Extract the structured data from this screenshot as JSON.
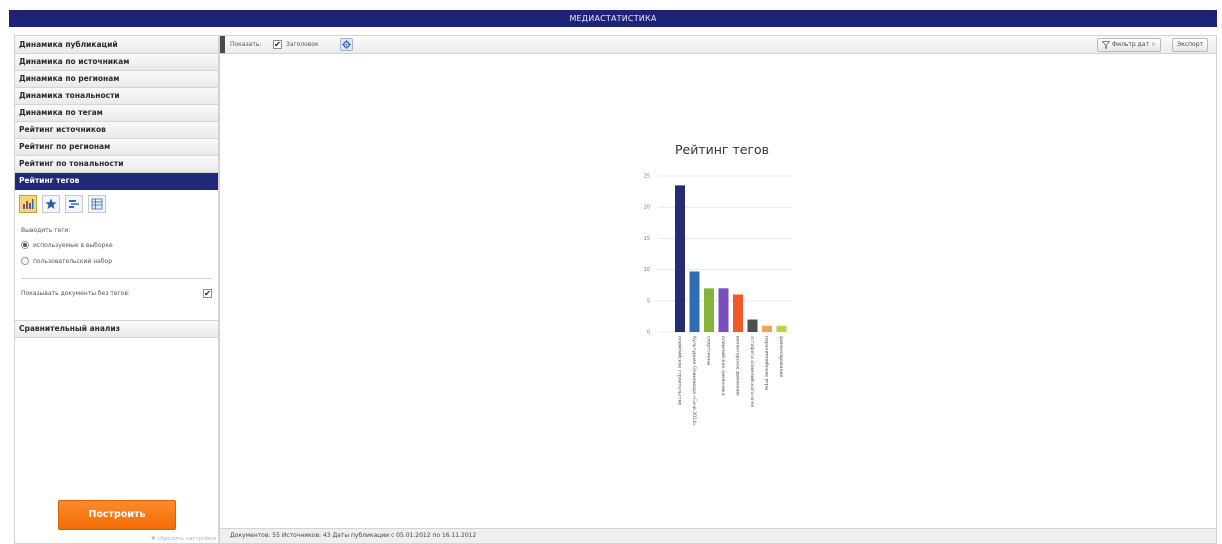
{
  "app": {
    "title": "МЕДИАСТАТИСТИКА"
  },
  "sidebar": {
    "items_top": [
      {
        "label": "Динамика публикаций"
      },
      {
        "label": "Динамика по источникам"
      },
      {
        "label": "Динамика по регионам"
      },
      {
        "label": "Динамика тональности"
      },
      {
        "label": "Динамика по тегам"
      },
      {
        "label": "Рейтинг источников"
      },
      {
        "label": "Рейтинг по регионам"
      },
      {
        "label": "Рейтинг по тональности"
      }
    ],
    "active_item": {
      "label": "Рейтинг тегов"
    },
    "panel": {
      "viz_icons": [
        "bar-chart-icon",
        "star-icon",
        "bars-icon",
        "table-icon"
      ],
      "tags_label": "Выводить теги:",
      "radio_options": [
        {
          "label": "используемые в выборке",
          "selected": true
        },
        {
          "label": "пользовательский набор",
          "selected": false
        }
      ],
      "no_tags_label": "Показывать документы без тегов:",
      "no_tags_checked": true,
      "check_mark": "✔"
    },
    "items_bottom": [
      {
        "label": "Сравнительный анализ"
      }
    ],
    "build_button": "Построить",
    "reset_link": "✖ сбросить настройки"
  },
  "toolbar": {
    "show_label": "Показать:",
    "header_label": "Заголовок",
    "header_checked": true,
    "check_mark": "✔",
    "date_filter_label": "Фильтр дат",
    "date_filter_close": "×",
    "export_label": "Экспорт"
  },
  "status": {
    "text": "Документов: 55  Источников: 43  Даты публикации с 05.01.2012 по 16.11.2012"
  },
  "colors": {
    "titlebar": "#1d2476",
    "active_item": "#1f2977",
    "build_button": "#f57a15"
  },
  "chart_data": {
    "type": "bar",
    "title": "Рейтинг тегов",
    "ylim": [
      0,
      25
    ],
    "y_ticks": [
      0,
      5,
      10,
      15,
      20,
      25
    ],
    "grid": true,
    "categories": [
      "олимпийское строительство",
      "Культурная Олимпиада «Сочи 2014»",
      "спортсмены",
      "олимпийская символика",
      "волонтерское движение",
      "эстафета олимпийского огня",
      "паралимпийские игры",
      "финансирование"
    ],
    "values": [
      23.5,
      9.7,
      7,
      7,
      6,
      2,
      1,
      1
    ],
    "colors": [
      "#262c72",
      "#2f6cb4",
      "#86b33a",
      "#7a4fbd",
      "#f05a28",
      "#4f4f4f",
      "#f5a25a",
      "#bfd33e"
    ]
  }
}
